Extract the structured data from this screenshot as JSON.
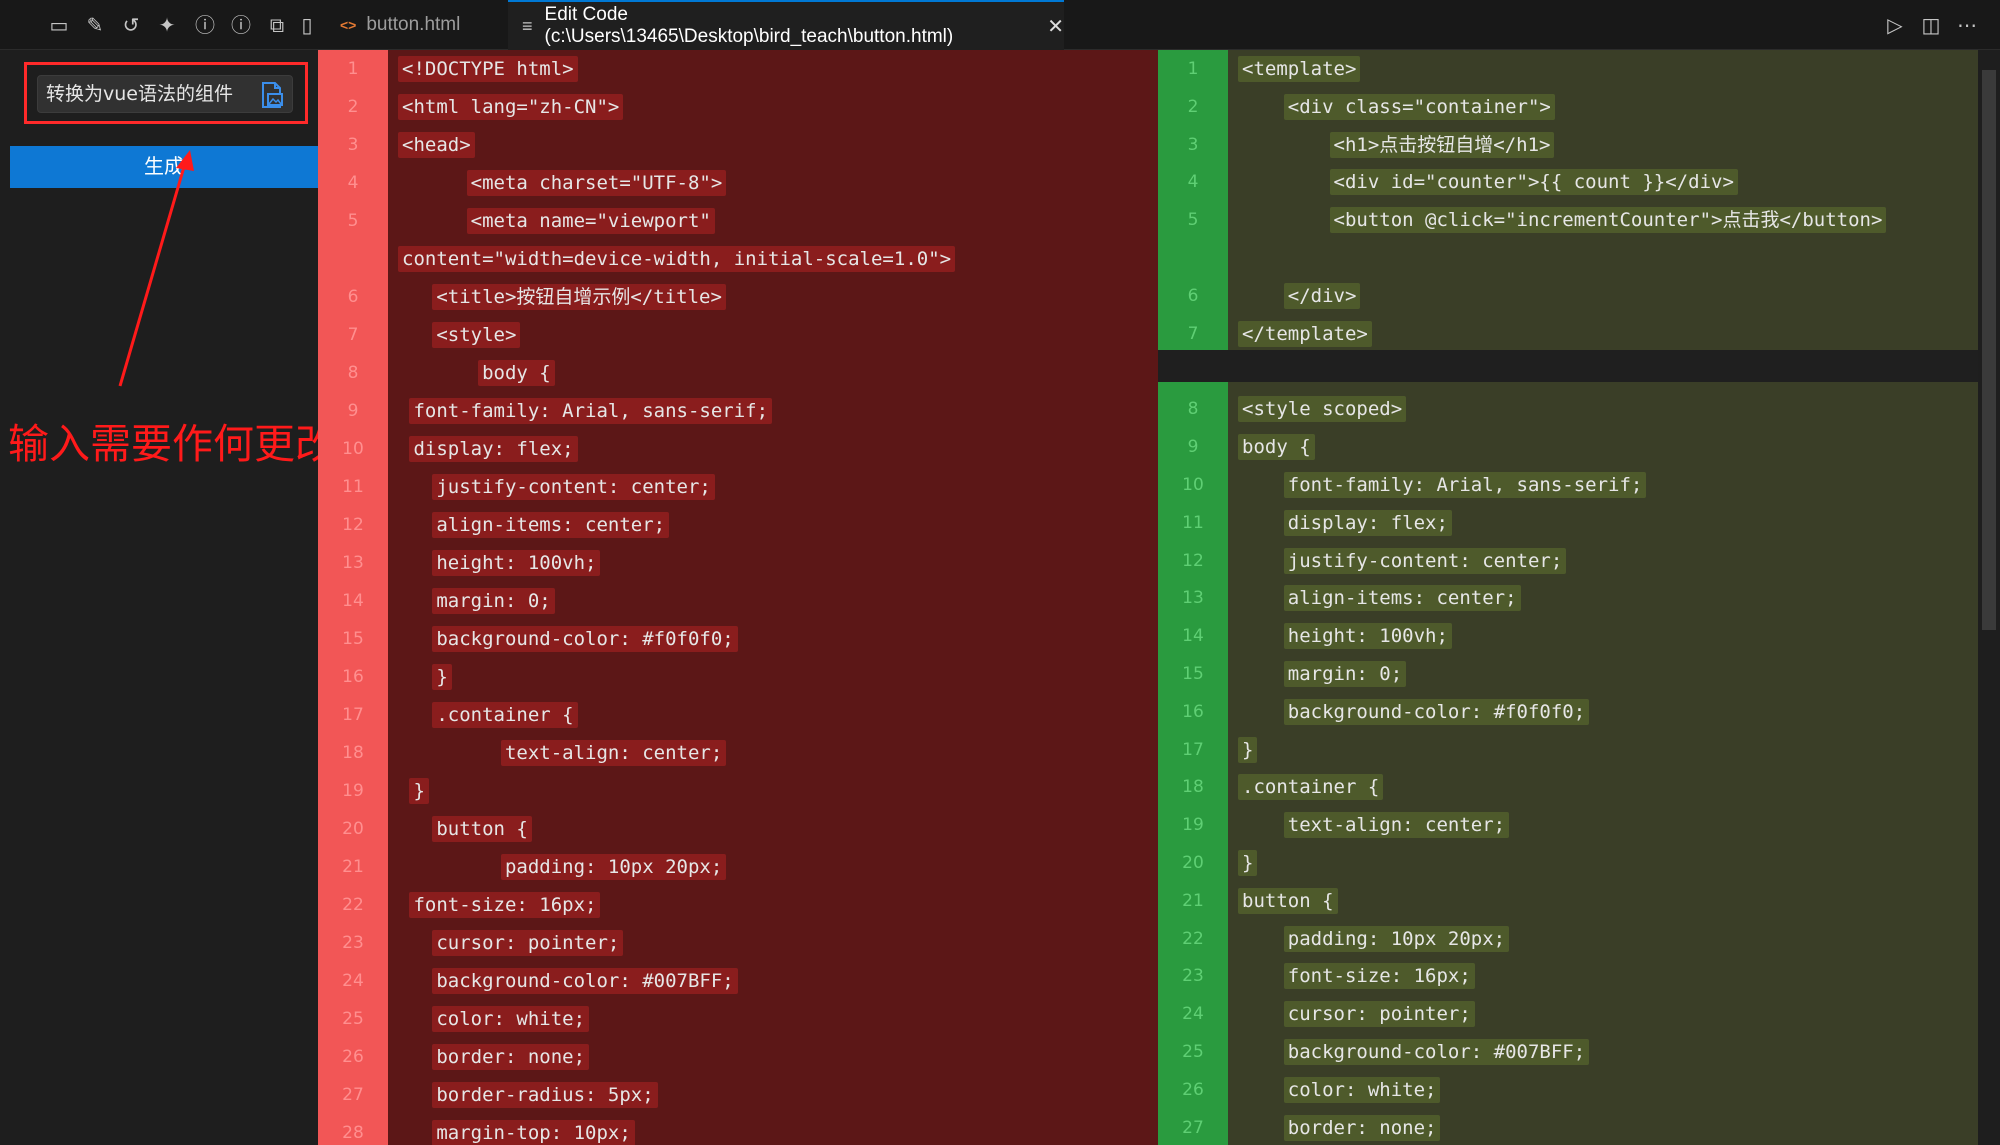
{
  "topbar": {
    "tab1_label": "button.html",
    "tab2_label": "Edit Code (c:\\Users\\13465\\Desktop\\bird_teach\\button.html)"
  },
  "sidebar": {
    "prompt_value": "转换为vue语法的组件",
    "generate_label": "生成",
    "annotation": "输入需要作何更改"
  },
  "colors": {
    "accent": "#0e78d4",
    "removed_gutter": "#f25656",
    "removed_bg": "#5c1717",
    "added_gutter": "#2a9b3f",
    "added_bg": "#3a3e27",
    "annotation": "#ff1a1a"
  },
  "left_lines": [
    {
      "n": "1",
      "text": "<!DOCTYPE html>"
    },
    {
      "n": "2",
      "text": "<html lang=\"zh-CN\">"
    },
    {
      "n": "3",
      "text": "<head>"
    },
    {
      "n": "4",
      "text": "      <meta charset=\"UTF-8\">"
    },
    {
      "n": "5",
      "text": "      <meta name=\"viewport\""
    },
    {
      "n": "",
      "text": "content=\"width=device-width, initial-scale=1.0\">"
    },
    {
      "n": "6",
      "text": "   <title>按钮自增示例</title>"
    },
    {
      "n": "7",
      "text": "   <style>"
    },
    {
      "n": "8",
      "text": "       body {"
    },
    {
      "n": "9",
      "text": " font-family: Arial, sans-serif;"
    },
    {
      "n": "10",
      "text": " display: flex;"
    },
    {
      "n": "11",
      "text": "   justify-content: center;"
    },
    {
      "n": "12",
      "text": "   align-items: center;"
    },
    {
      "n": "13",
      "text": "   height: 100vh;"
    },
    {
      "n": "14",
      "text": "   margin: 0;"
    },
    {
      "n": "15",
      "text": "   background-color: #f0f0f0;"
    },
    {
      "n": "16",
      "text": "   }"
    },
    {
      "n": "17",
      "text": "   .container {"
    },
    {
      "n": "18",
      "text": "         text-align: center;"
    },
    {
      "n": "19",
      "text": " }"
    },
    {
      "n": "20",
      "text": "   button {"
    },
    {
      "n": "21",
      "text": "         padding: 10px 20px;"
    },
    {
      "n": "22",
      "text": " font-size: 16px;"
    },
    {
      "n": "23",
      "text": "   cursor: pointer;"
    },
    {
      "n": "24",
      "text": "   background-color: #007BFF;"
    },
    {
      "n": "25",
      "text": "   color: white;"
    },
    {
      "n": "26",
      "text": "   border: none;"
    },
    {
      "n": "27",
      "text": "   border-radius: 5px;"
    },
    {
      "n": "28",
      "text": "   margin-top: 10px;"
    }
  ],
  "right_lines": [
    {
      "n": "1",
      "text": "<template>"
    },
    {
      "n": "2",
      "text": "    <div class=\"container\">"
    },
    {
      "n": "3",
      "text": "        <h1>点击按钮自增</h1>"
    },
    {
      "n": "4",
      "text": "        <div id=\"counter\">{{ count }}</div>"
    },
    {
      "n": "5",
      "text": "        <button @click=\"incrementCounter\">点击我</button>"
    },
    {
      "n": "",
      "text": ""
    },
    {
      "n": "6",
      "text": "    </div>"
    },
    {
      "n": "7",
      "text": "</template>"
    },
    {
      "n": "8",
      "text": "<style scoped>"
    },
    {
      "n": "9",
      "text": "body {"
    },
    {
      "n": "10",
      "text": "    font-family: Arial, sans-serif;"
    },
    {
      "n": "11",
      "text": "    display: flex;"
    },
    {
      "n": "12",
      "text": "    justify-content: center;"
    },
    {
      "n": "13",
      "text": "    align-items: center;"
    },
    {
      "n": "14",
      "text": "    height: 100vh;"
    },
    {
      "n": "15",
      "text": "    margin: 0;"
    },
    {
      "n": "16",
      "text": "    background-color: #f0f0f0;"
    },
    {
      "n": "17",
      "text": "}"
    },
    {
      "n": "18",
      "text": ".container {"
    },
    {
      "n": "19",
      "text": "    text-align: center;"
    },
    {
      "n": "20",
      "text": "}"
    },
    {
      "n": "21",
      "text": "button {"
    },
    {
      "n": "22",
      "text": "    padding: 10px 20px;"
    },
    {
      "n": "23",
      "text": "    font-size: 16px;"
    },
    {
      "n": "24",
      "text": "    cursor: pointer;"
    },
    {
      "n": "25",
      "text": "    background-color: #007BFF;"
    },
    {
      "n": "26",
      "text": "    color: white;"
    },
    {
      "n": "27",
      "text": "    border: none;"
    }
  ]
}
